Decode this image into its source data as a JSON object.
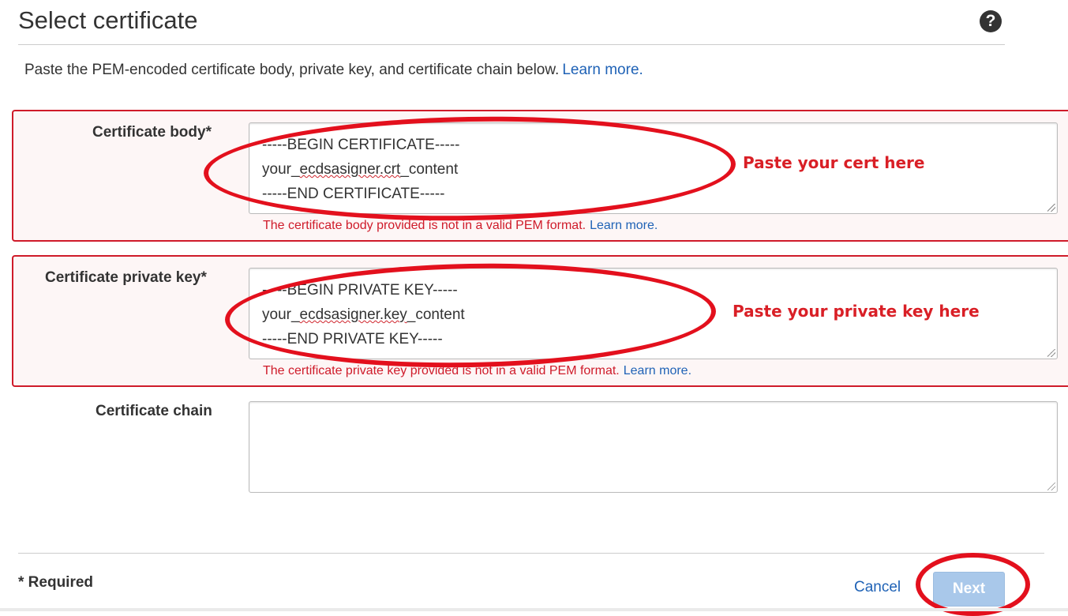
{
  "header": {
    "title": "Select certificate",
    "help_icon": "question-circle-icon"
  },
  "intro": {
    "text": "Paste the PEM-encoded certificate body, private key, and certificate chain below.",
    "link": "Learn more."
  },
  "fields": {
    "body": {
      "label": "Certificate body*",
      "lines": [
        "-----BEGIN CERTIFICATE-----",
        "your_",
        "ecdsasigner.crt",
        "_content",
        "-----END CERTIFICATE-----"
      ],
      "error": "The certificate body provided is not in a valid PEM format.",
      "error_link": "Learn more."
    },
    "key": {
      "label": "Certificate private key*",
      "lines": [
        "-----BEGIN PRIVATE KEY-----",
        "your_",
        "ecdsasigner.key",
        "_content",
        "-----END PRIVATE KEY-----"
      ],
      "error": "The certificate private key provided is not in a valid PEM format.",
      "error_link": "Learn more."
    },
    "chain": {
      "label": "Certificate chain",
      "value": ""
    }
  },
  "annotations": {
    "cert": "Paste your cert here",
    "key": "Paste your private key here"
  },
  "footer": {
    "required": "* Required",
    "cancel": "Cancel",
    "next": "Next"
  },
  "colors": {
    "error": "#cf1b2a",
    "link": "#1f62b6",
    "annotation": "#e3101d",
    "next_disabled": "#a9c8ea"
  }
}
